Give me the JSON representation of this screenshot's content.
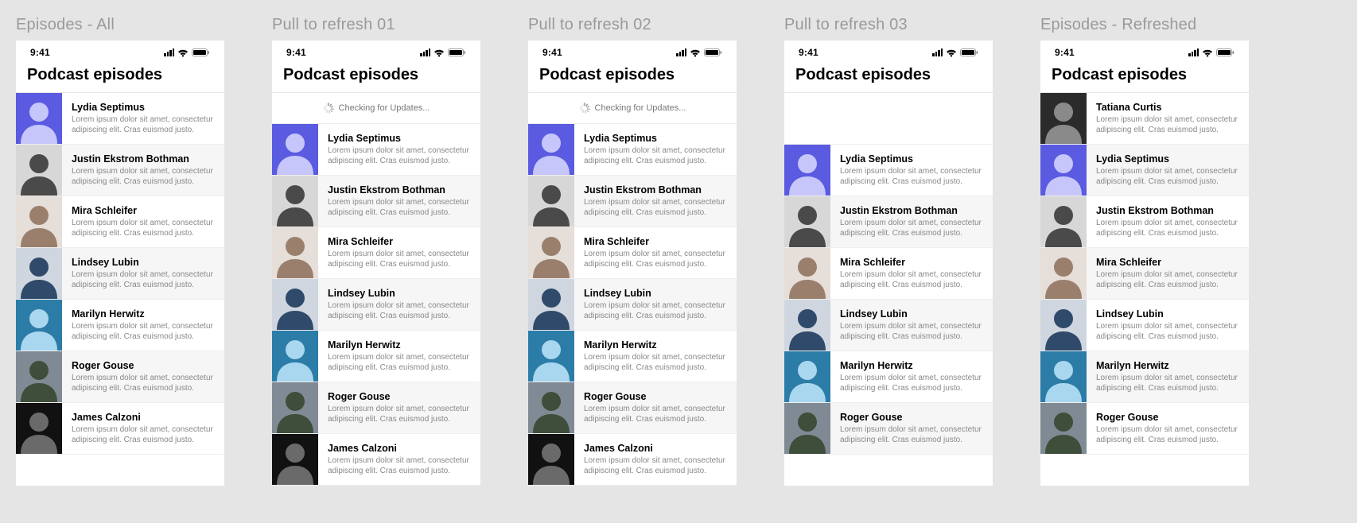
{
  "status": {
    "time": "9:41"
  },
  "header": {
    "title": "Podcast episodes"
  },
  "refresh": {
    "text": "Checking for Updates..."
  },
  "lorem": "Lorem ipsum dolor sit amet, consectetur adipiscing elit. Cras euismod justo.",
  "people": {
    "tatiana": {
      "name": "Tatiana Curtis"
    },
    "lydia": {
      "name": "Lydia Septimus"
    },
    "justin": {
      "name": "Justin Ekstrom Bothman"
    },
    "mira": {
      "name": "Mira Schleifer"
    },
    "lindsey": {
      "name": "Lindsey Lubin"
    },
    "marilyn": {
      "name": "Marilyn Herwitz"
    },
    "roger": {
      "name": "Roger Gouse"
    },
    "james": {
      "name": "James Calzoni"
    }
  },
  "avatarColors": {
    "tatiana": {
      "bg": "#2b2b2b",
      "fg": "#8a8a8a"
    },
    "lydia": {
      "bg": "#5a5be0",
      "fg": "#c6c6fb"
    },
    "justin": {
      "bg": "#d7d7d7",
      "fg": "#4a4a4a"
    },
    "mira": {
      "bg": "#e6ded8",
      "fg": "#9a7f6d"
    },
    "lindsey": {
      "bg": "#cfd6df",
      "fg": "#2f4a6a"
    },
    "marilyn": {
      "bg": "#2c7ca8",
      "fg": "#a8d7ef"
    },
    "roger": {
      "bg": "#7f8a94",
      "fg": "#3e4e3a"
    },
    "james": {
      "bg": "#111111",
      "fg": "#6a6a6a"
    }
  },
  "screens": [
    {
      "label": "Episodes - All",
      "offset": "none",
      "order": [
        "lydia",
        "justin",
        "mira",
        "lindsey",
        "marilyn",
        "roger",
        "james"
      ]
    },
    {
      "label": "Pull to refresh 01",
      "offset": "refresh",
      "order": [
        "lydia",
        "justin",
        "mira",
        "lindsey",
        "marilyn",
        "roger",
        "james"
      ]
    },
    {
      "label": "Pull to refresh 02",
      "offset": "refresh",
      "order": [
        "lydia",
        "justin",
        "mira",
        "lindsey",
        "marilyn",
        "roger",
        "james"
      ]
    },
    {
      "label": "Pull to refresh 03",
      "offset": "blank",
      "order": [
        "lydia",
        "justin",
        "mira",
        "lindsey",
        "marilyn",
        "roger"
      ]
    },
    {
      "label": "Episodes - Refreshed",
      "offset": "none",
      "order": [
        "tatiana",
        "lydia",
        "justin",
        "mira",
        "lindsey",
        "marilyn",
        "roger"
      ]
    }
  ]
}
